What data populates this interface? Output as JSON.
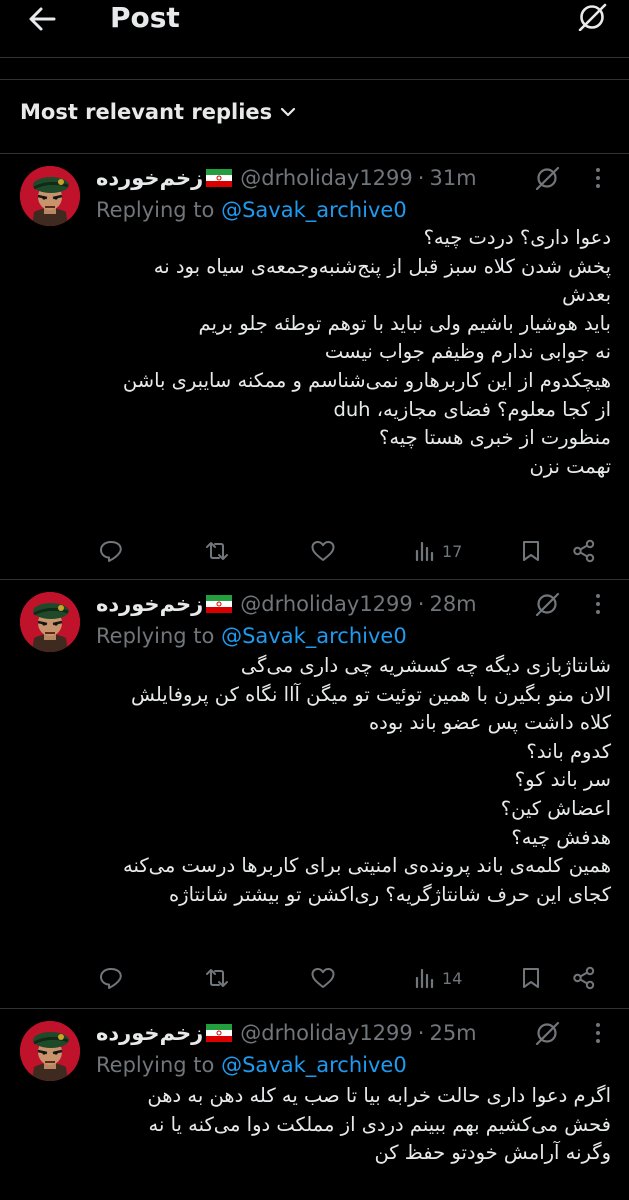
{
  "header": {
    "title": "Post"
  },
  "filter": {
    "label": "Most relevant replies"
  },
  "replies": [
    {
      "name": "زخم‌خورده",
      "handle": "@drholiday1299",
      "time": "31m",
      "replying_prefix": "Replying to",
      "replying_to": "@Savak_archive0",
      "lines": [
        "دعوا داری؟ دردت چیه؟",
        "پخش شدن کلاه سبز قبل از پنج‌شنبه‌وجمعه‌ی سیاه بود نه",
        "بعدش",
        "باید هوشیار باشیم ولی نباید با توهم توطئه جلو بریم",
        "نه جوابی ندارم وظیفم جواب نیست",
        "هیچکدوم از این کاربرهارو نمی‌شناسم و ممکنه سایبری باشن",
        "از کجا معلوم؟ فضای مجازیه، duh",
        "منظورت از خبری هستا چیه؟",
        "تهمت نزن"
      ],
      "views": "17"
    },
    {
      "name": "زخم‌خورده",
      "handle": "@drholiday1299",
      "time": "28m",
      "replying_prefix": "Replying to",
      "replying_to": "@Savak_archive0",
      "lines": [
        "شانتاژبازی دیگه چه کسشریه چی داری می‌گی",
        "الان منو بگیرن با همین توئیت تو میگن آاا نگاه کن پروفایلش",
        "کلاه داشت پس عضو باند بوده",
        "کدوم باند؟",
        "سر باند کو؟",
        "اعضاش کین؟",
        "هدفش چیه؟",
        "همین کلمه‌ی باند پرونده‌ی امنیتی برای کاربرها درست می‌کنه",
        "کجای این حرف شانتاژگریه؟ ری‌اکشن تو بیشتر شانتاژه"
      ],
      "views": "14"
    },
    {
      "name": "زخم‌خورده",
      "handle": "@drholiday1299",
      "time": "25m",
      "replying_prefix": "Replying to",
      "replying_to": "@Savak_archive0",
      "lines": [
        "اگرم دعوا داری حالت خرابه بیا تا صب یه کله دهن به دهن",
        "فحش می‌کشیم بهم ببینم دردی از مملکت دوا می‌کنه یا نه",
        "وگرنه آرامش خودتو حفظ کن"
      ]
    }
  ],
  "icons": {
    "back": "arrow-left-icon",
    "grok": "grok-icon",
    "more": "more-dots-icon",
    "reply": "reply-icon",
    "repost": "repost-icon",
    "like": "like-icon",
    "views": "views-icon",
    "bookmark": "bookmark-icon",
    "share": "share-icon"
  },
  "colors": {
    "background": "#000000",
    "text": "#e7e9ea",
    "muted": "#71767b",
    "link": "#1d9bf0",
    "divider": "#2f3336"
  }
}
